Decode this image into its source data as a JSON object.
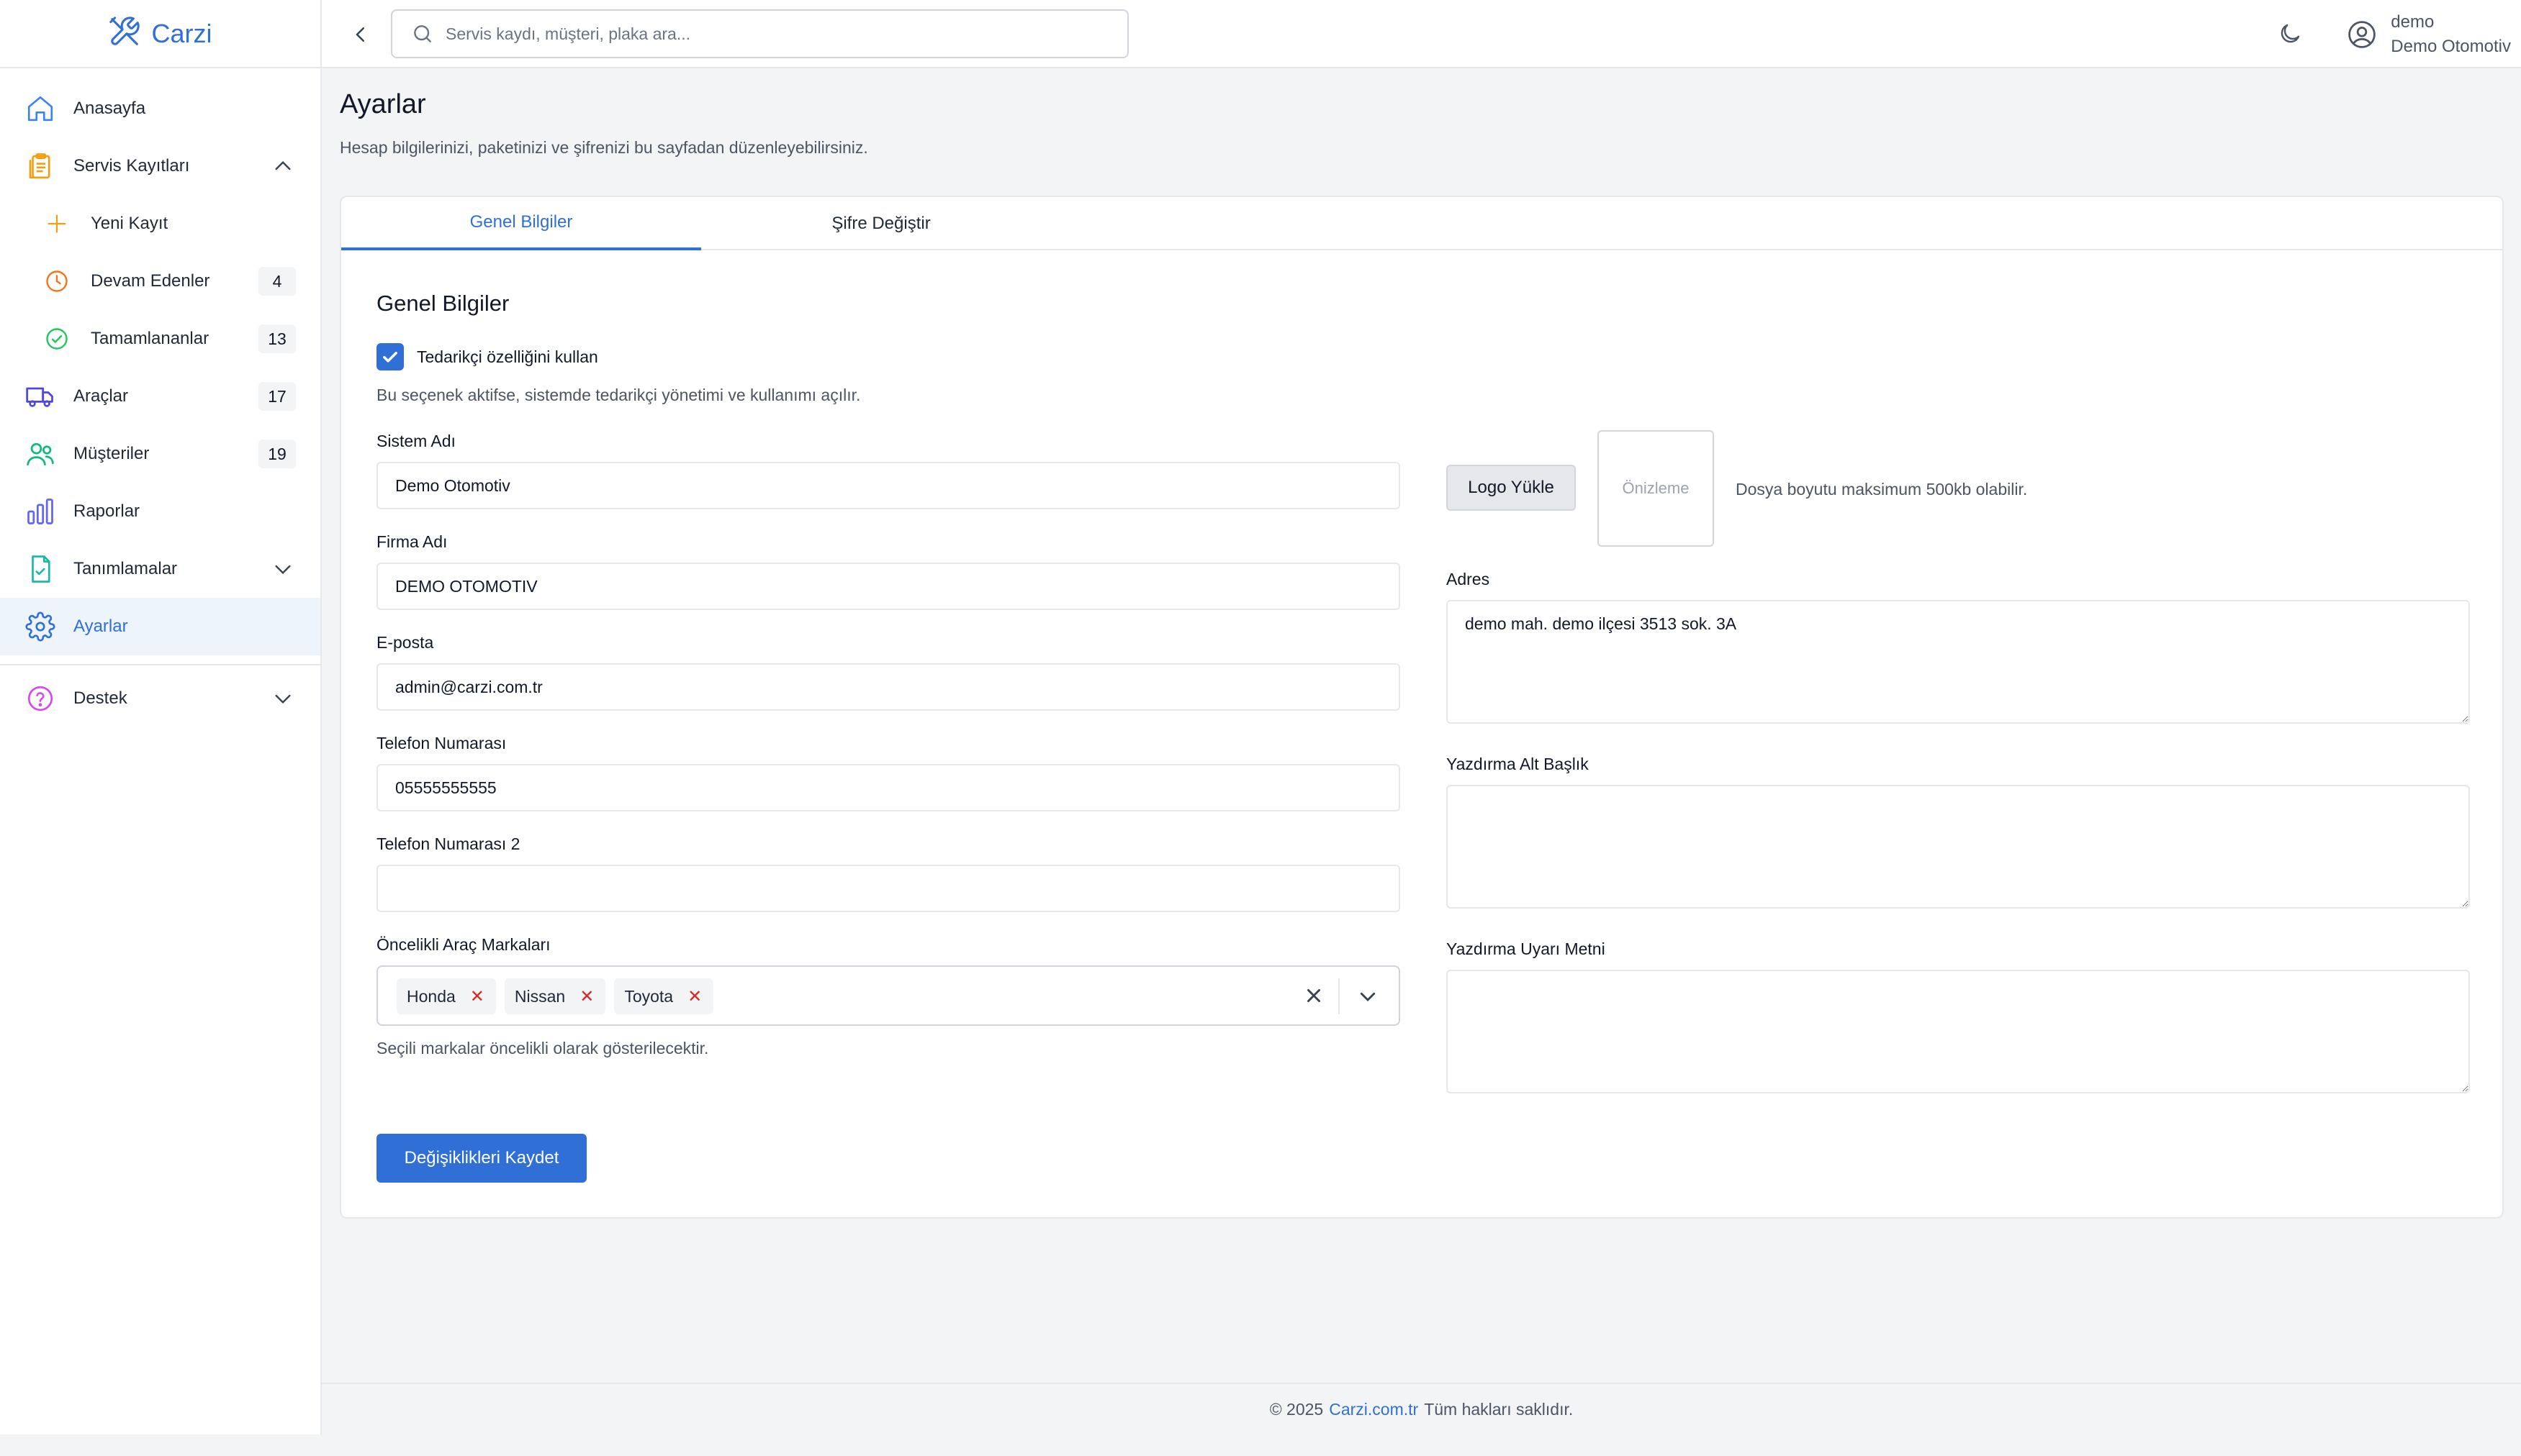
{
  "brand": {
    "name": "Carzi",
    "icon": "wrench-screwdriver-icon"
  },
  "sidebar": {
    "items": [
      {
        "label": "Anasayfa",
        "icon": "home-icon"
      },
      {
        "label": "Servis Kayıtları",
        "icon": "clipboard-icon",
        "expanded": true
      },
      {
        "label": "Yeni Kayıt",
        "icon": "plus-icon"
      },
      {
        "label": "Devam Edenler",
        "icon": "clock-icon",
        "count": "4"
      },
      {
        "label": "Tamamlananlar",
        "icon": "check-circle-icon",
        "count": "13"
      },
      {
        "label": "Araçlar",
        "icon": "truck-icon",
        "count": "17"
      },
      {
        "label": "Müşteriler",
        "icon": "users-icon",
        "count": "19"
      },
      {
        "label": "Raporlar",
        "icon": "bar-chart-icon"
      },
      {
        "label": "Tanımlamalar",
        "icon": "document-check-icon",
        "expanded": false
      },
      {
        "label": "Ayarlar",
        "icon": "gear-icon",
        "active": true
      },
      {
        "label": "Destek",
        "icon": "help-circle-icon",
        "expanded": false
      }
    ]
  },
  "header": {
    "search_placeholder": "Servis kaydı, müşteri, plaka ara...",
    "user_name": "demo",
    "user_company": "Demo Otomotiv"
  },
  "page": {
    "title": "Ayarlar",
    "subtitle": "Hesap bilgilerinizi, paketinizi ve şifrenizi bu sayfadan düzenleyebilirsiniz."
  },
  "tabs": [
    {
      "label": "Genel Bilgiler",
      "active": true
    },
    {
      "label": "Şifre Değiştir",
      "active": false
    }
  ],
  "form": {
    "section_title": "Genel Bilgiler",
    "supplier_checkbox": {
      "label": "Tedarikçi özelliğini kullan",
      "checked": true
    },
    "supplier_help": "Bu seçenek aktifse, sistemde tedarikçi yönetimi ve kullanımı açılır.",
    "system_name": {
      "label": "Sistem Adı",
      "value": "Demo Otomotiv"
    },
    "company_name": {
      "label": "Firma Adı",
      "value": "DEMO OTOMOTIV"
    },
    "email": {
      "label": "E-posta",
      "value": "admin@carzi.com.tr"
    },
    "phone": {
      "label": "Telefon Numarası",
      "value": "05555555555"
    },
    "phone2": {
      "label": "Telefon Numarası 2",
      "value": ""
    },
    "brands": {
      "label": "Öncelikli Araç Markaları",
      "selected": [
        "Honda",
        "Nissan",
        "Toyota"
      ],
      "help": "Seçili markalar öncelikli olarak gösterilecektir."
    },
    "logo": {
      "button": "Logo Yükle",
      "preview": "Önizleme",
      "note": "Dosya boyutu maksimum 500kb olabilir."
    },
    "address": {
      "label": "Adres",
      "value": "demo mah. demo ilçesi 3513 sok. 3A"
    },
    "print_subtitle": {
      "label": "Yazdırma Alt Başlık",
      "value": ""
    },
    "print_warning": {
      "label": "Yazdırma Uyarı Metni",
      "value": ""
    },
    "save_button": "Değişiklikleri Kaydet"
  },
  "footer": {
    "prefix": "© 2025",
    "link": "Carzi.com.tr",
    "suffix": "Tüm hakları saklıdır."
  },
  "colors": {
    "accent": "#2f6fd6",
    "danger": "#dc2626",
    "home": "#3b82f6",
    "clipboard": "#f59e0b",
    "clock": "#f97316",
    "check": "#22c55e",
    "truck": "#4f46e5",
    "users": "#10b981",
    "chart": "#6366f1",
    "docs": "#14b8a6",
    "help": "#d946ef"
  }
}
